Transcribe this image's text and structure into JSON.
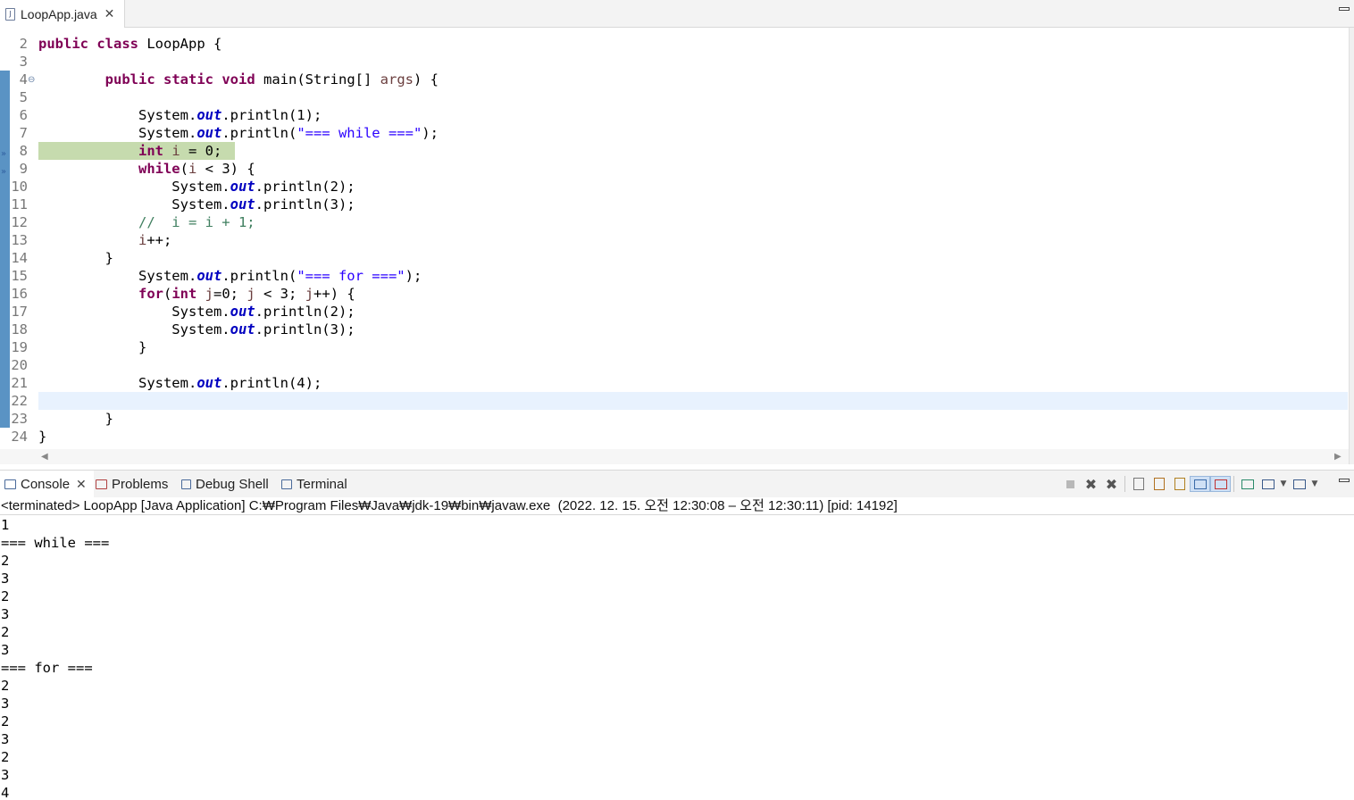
{
  "editor": {
    "tab_title": "LoopApp.java",
    "tab_close": "✕",
    "lines": [
      {
        "n": "2",
        "code": "<span class=\"kw\">public</span> <span class=\"kw\">class</span> LoopApp {"
      },
      {
        "n": "3",
        "code": ""
      },
      {
        "n": "4",
        "code": "        <span class=\"kw\">public</span> <span class=\"kw\">static</span> <span class=\"kw\">void</span> main(String[] <span class=\"var\">args</span>) {",
        "fold": true
      },
      {
        "n": "5",
        "code": ""
      },
      {
        "n": "6",
        "code": "            System.<span class=\"fld\">out</span>.println(1);"
      },
      {
        "n": "7",
        "code": "            System.<span class=\"fld\">out</span>.println(<span class=\"str\">\"=== while ===\"</span>);"
      },
      {
        "n": "8",
        "code": "            <span class=\"kw\">int</span> <span class=\"var\">i</span> = 0;",
        "breakpoint": true
      },
      {
        "n": "9",
        "code": "            <span class=\"kw\">while</span>(<span class=\"var\">i</span> &lt; 3) {",
        "breakpoint": true
      },
      {
        "n": "10",
        "code": "                System.<span class=\"fld\">out</span>.println(2);"
      },
      {
        "n": "11",
        "code": "                System.<span class=\"fld\">out</span>.println(3);"
      },
      {
        "n": "12",
        "code": "            <span class=\"cmt\">//  i = i + 1;</span>"
      },
      {
        "n": "13",
        "code": "            <span class=\"var\">i</span>++;"
      },
      {
        "n": "14",
        "code": "        }"
      },
      {
        "n": "15",
        "code": "            System.<span class=\"fld\">out</span>.println(<span class=\"str\">\"=== for ===\"</span>);"
      },
      {
        "n": "16",
        "code": "            <span class=\"kw\">for</span>(<span class=\"kw\">int</span> <span class=\"var\">j</span>=0; <span class=\"var\">j</span> &lt; 3; <span class=\"var\">j</span>++) {"
      },
      {
        "n": "17",
        "code": "                System.<span class=\"fld\">out</span>.println(2);"
      },
      {
        "n": "18",
        "code": "                System.<span class=\"fld\">out</span>.println(3);"
      },
      {
        "n": "19",
        "code": "            }"
      },
      {
        "n": "20",
        "code": ""
      },
      {
        "n": "21",
        "code": "            System.<span class=\"fld\">out</span>.println(4);"
      },
      {
        "n": "22",
        "code": "",
        "current": true
      },
      {
        "n": "23",
        "code": "        }"
      },
      {
        "n": "24",
        "code": "}"
      }
    ]
  },
  "console_view": {
    "tabs": [
      {
        "label": "Console",
        "active": true,
        "closable": true
      },
      {
        "label": "Problems"
      },
      {
        "label": "Debug Shell"
      },
      {
        "label": "Terminal"
      }
    ],
    "close_glyph": "✕",
    "status": "<terminated> LoopApp [Java Application] C:₩Program Files₩Java₩jdk-19₩bin₩javaw.exe  (2022. 12. 15. 오전 12:30:08 – 오전 12:30:11) [pid: 14192]",
    "output": [
      "1",
      "=== while ===",
      "2",
      "3",
      "2",
      "3",
      "2",
      "3",
      "=== for ===",
      "2",
      "3",
      "2",
      "3",
      "2",
      "3",
      "4"
    ]
  },
  "toolbar_icons": [
    "terminate-icon",
    "remove-launch-icon",
    "remove-all-launches-icon",
    "clear-console-icon",
    "scroll-lock-icon",
    "word-wrap-icon",
    "show-on-stdout-icon",
    "show-on-stderr-icon",
    "pin-console-icon",
    "display-console-icon",
    "open-console-icon"
  ]
}
